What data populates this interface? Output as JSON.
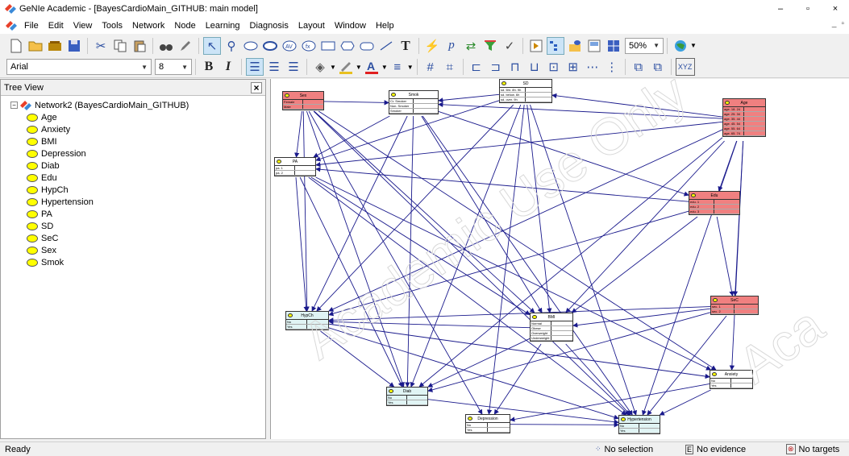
{
  "window": {
    "title": "GeNIe Academic - [BayesCardioMain_GITHUB: main model]",
    "minimize": "–",
    "restore": "▫",
    "close": "×"
  },
  "menu": [
    "File",
    "Edit",
    "View",
    "Tools",
    "Network",
    "Node",
    "Learning",
    "Diagnosis",
    "Layout",
    "Window",
    "Help"
  ],
  "toolbar": {
    "zoom": "50%",
    "font": "Arial",
    "font_size": "8",
    "bold_label": "B",
    "italic_label": "I",
    "text_tool": "T"
  },
  "tree": {
    "header": "Tree View",
    "close": "×",
    "root": "Network2 (BayesCardioMain_GITHUB)",
    "items": [
      "Age",
      "Anxiety",
      "BMI",
      "Depression",
      "Diab",
      "Edu",
      "HypCh",
      "Hypertension",
      "PA",
      "SD",
      "SeC",
      "Sex",
      "Smok"
    ]
  },
  "nodes": {
    "sex": {
      "name": "Sex",
      "states": [
        "Female",
        "Male"
      ]
    },
    "smok": {
      "name": "Smok",
      "states": [
        "Cr. Smoker",
        "Non. Smoker",
        "Smoker"
      ]
    },
    "sd": {
      "name": "SD",
      "states": [
        "sd. 6hr. 8h. 9h",
        "sd. below. 6h",
        "sd. over. 9h"
      ]
    },
    "age": {
      "name": "Age",
      "states": [
        "age. 18. 24",
        "age. 25. 34",
        "age. 35. 44",
        "age. 45. 54",
        "age. 55. 64",
        "age. 65. 74"
      ]
    },
    "pa": {
      "name": "PA",
      "states": [
        "pa. 1",
        "pa. 2"
      ]
    },
    "edu": {
      "name": "Edu",
      "states": [
        "edu. 1",
        "edu. 2",
        "edu. 3"
      ]
    },
    "sec": {
      "name": "SeC",
      "states": [
        "sec. 1",
        "sec. 2"
      ]
    },
    "hypch": {
      "name": "HypCh",
      "states": [
        "No",
        "Yes"
      ]
    },
    "bmi": {
      "name": "BMI",
      "states": [
        "Normal",
        "Obese",
        "Overweight",
        "Underweight"
      ]
    },
    "anxiety": {
      "name": "Anxiety",
      "states": [
        "No",
        "Yes"
      ]
    },
    "diab": {
      "name": "Diab",
      "states": [
        "No",
        "Yes"
      ]
    },
    "depression": {
      "name": "Depression",
      "states": [
        "No",
        "Yes"
      ]
    },
    "hypertension": {
      "name": "Hypertension",
      "states": [
        "No",
        "Yes"
      ]
    }
  },
  "status": {
    "ready": "Ready",
    "selection": "No selection",
    "evidence": "No evidence",
    "targets": "No targets"
  },
  "colors": {
    "edge": "#1a1a8c",
    "observed": "#f08080",
    "target": "#e0f4f4"
  }
}
